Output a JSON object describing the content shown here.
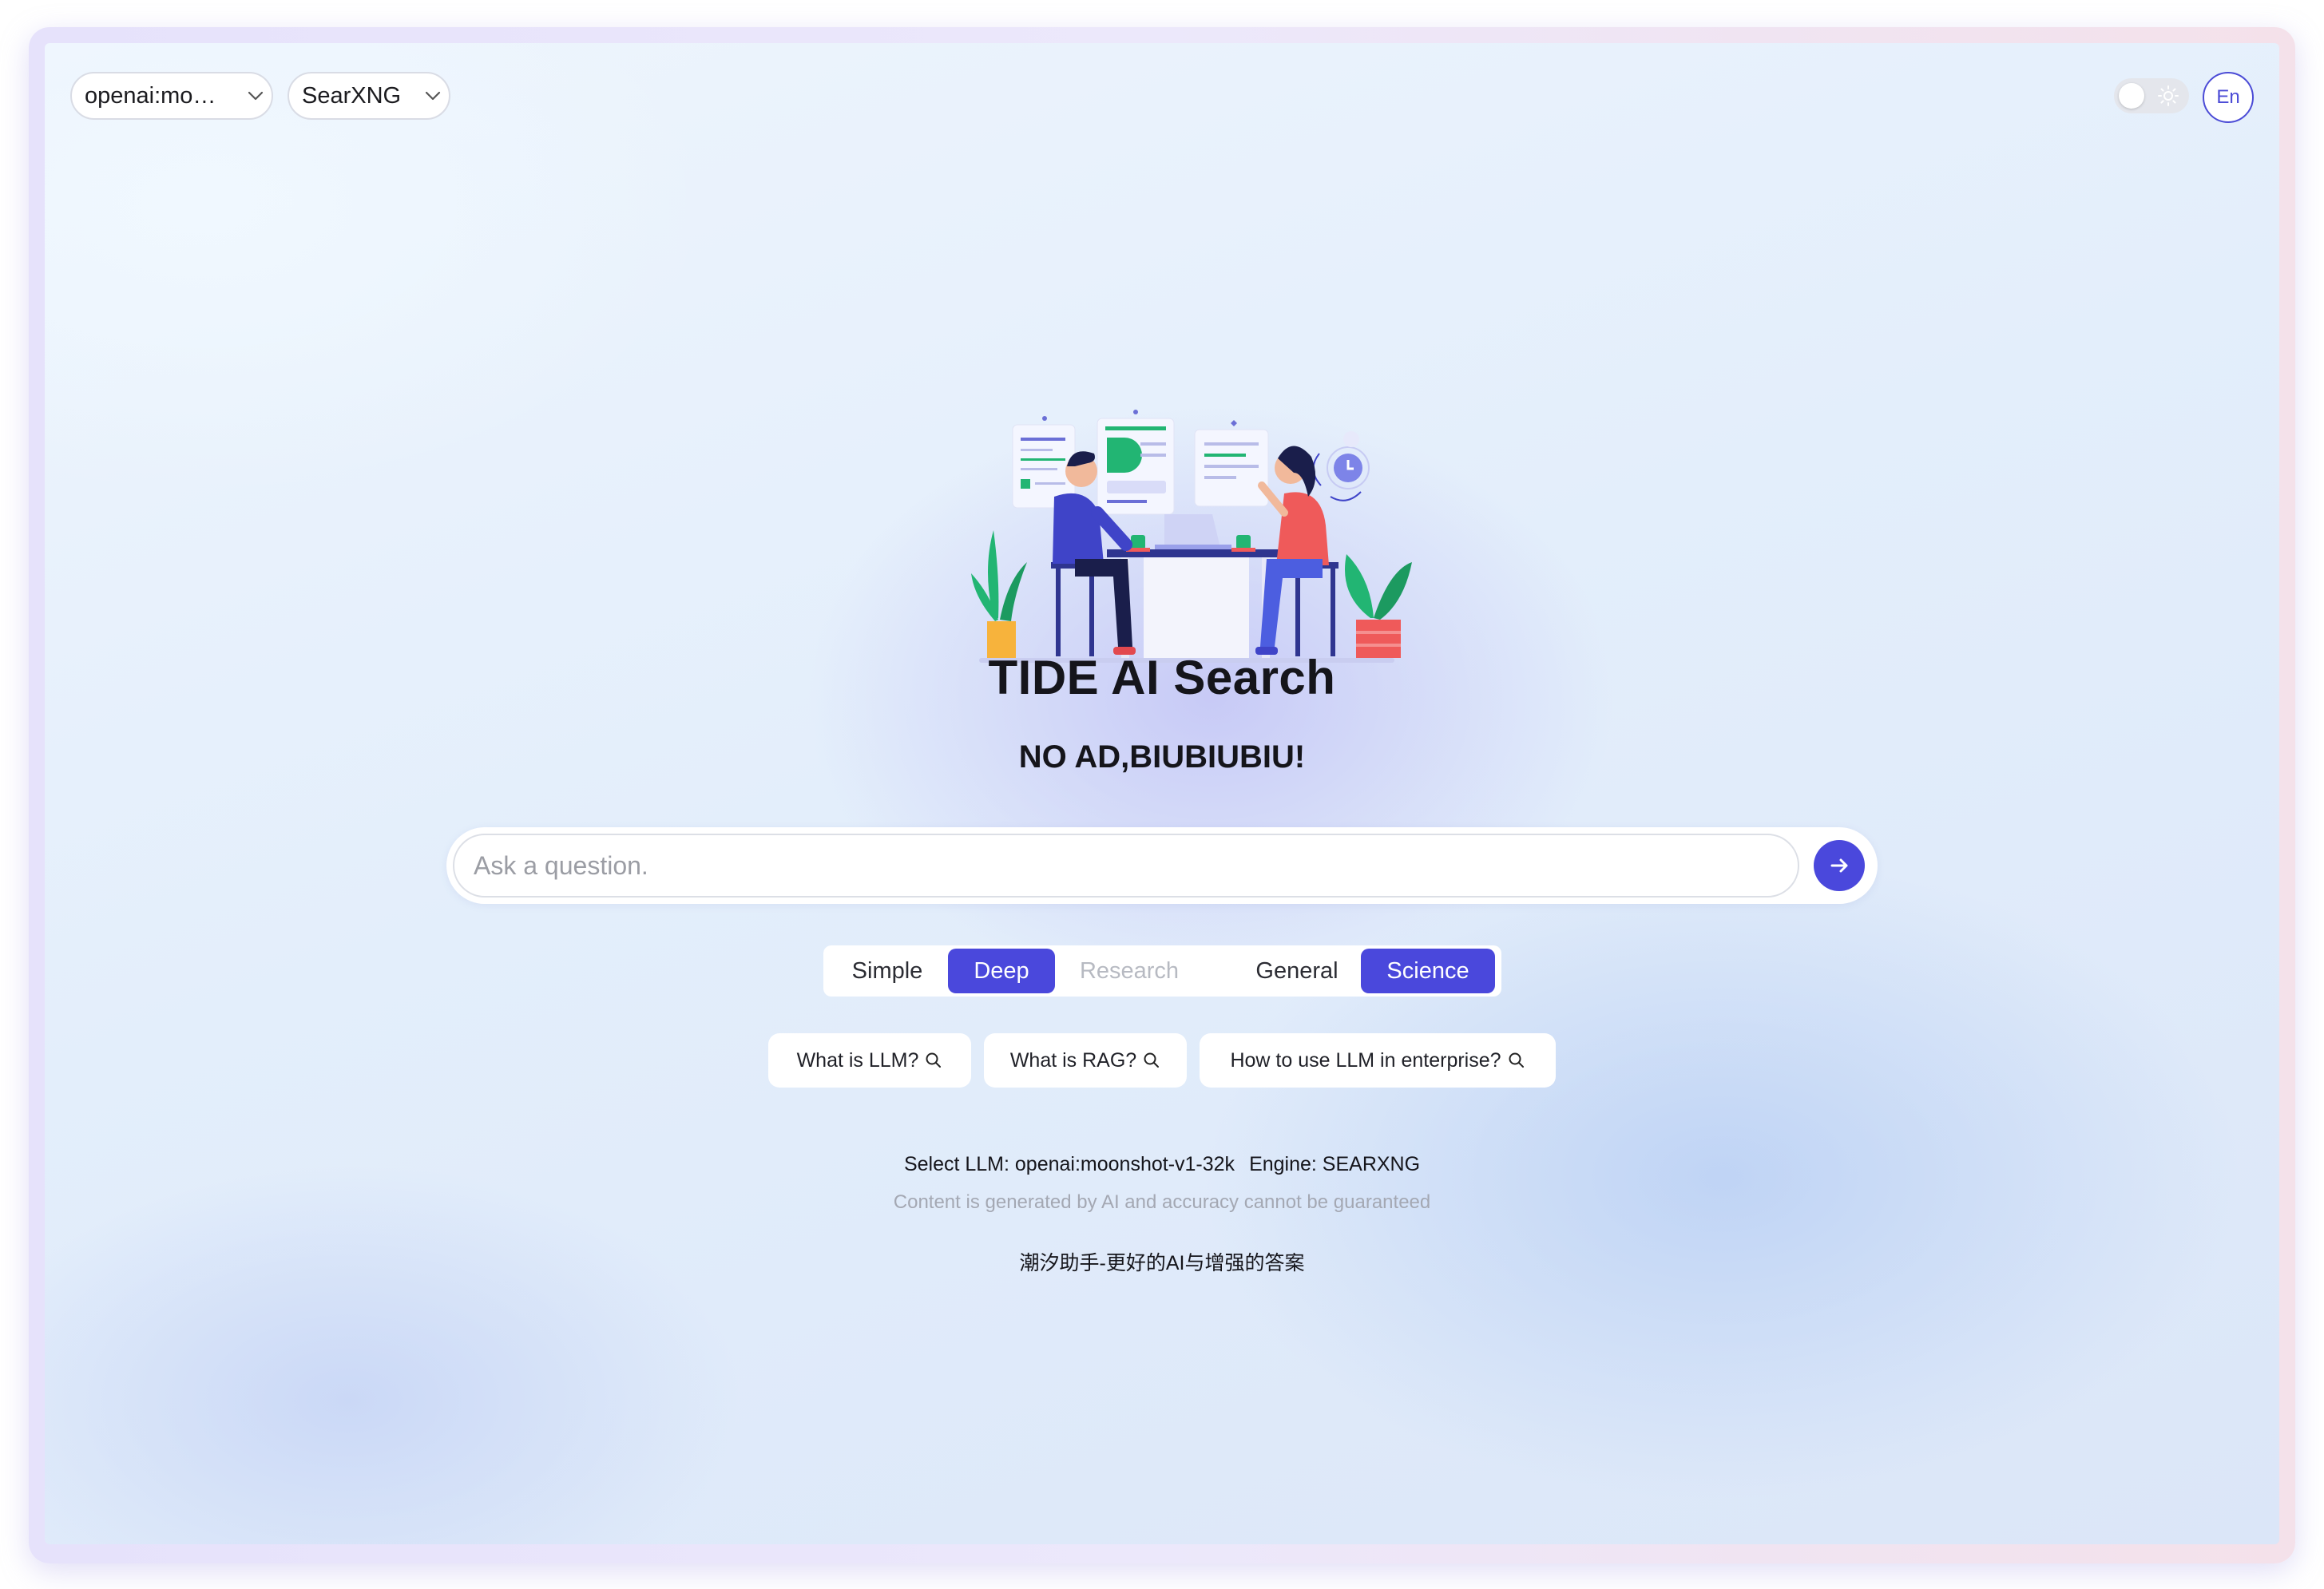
{
  "header": {
    "llm_select": {
      "value": "openai:mo…"
    },
    "engine_select": {
      "value": "SearXNG"
    },
    "theme_toggle": {
      "state": "light"
    },
    "language_button": {
      "label": "En"
    }
  },
  "hero": {
    "title": "TIDE AI Search",
    "subtitle": "NO AD,BIUBIUBIU!"
  },
  "search": {
    "placeholder": "Ask a question.",
    "value": ""
  },
  "mode_options": [
    {
      "label": "Simple",
      "state": "normal"
    },
    {
      "label": "Deep",
      "state": "selected"
    },
    {
      "label": "Research",
      "state": "disabled"
    }
  ],
  "source_options": [
    {
      "label": "General",
      "state": "normal"
    },
    {
      "label": "Science",
      "state": "selected"
    }
  ],
  "suggestions": [
    {
      "label": "What is LLM?"
    },
    {
      "label": "What is RAG?"
    },
    {
      "label": "How to use LLM in enterprise?"
    }
  ],
  "footer": {
    "selected_llm": "Select LLM: openai:moonshot-v1-32k",
    "engine": "Engine: SEARXNG",
    "disclaimer": "Content is generated by AI and accuracy cannot be guaranteed",
    "slogan": "潮汐助手-更好的AI与增强的答案"
  },
  "colors": {
    "accent": "#4a48dc",
    "text_primary": "#15151b",
    "text_muted": "#a4a8b3"
  },
  "icons": [
    "chevron-down-icon",
    "sun-icon",
    "arrow-right-icon",
    "search-icon",
    "team-meeting-illustration"
  ]
}
